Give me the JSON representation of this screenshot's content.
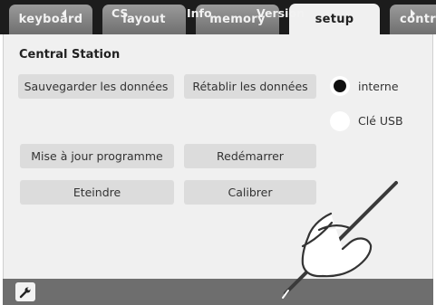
{
  "tabs": [
    {
      "label": "keyboard",
      "active": false
    },
    {
      "label": "layout",
      "active": false
    },
    {
      "label": "memory",
      "active": false
    },
    {
      "label": "setup",
      "active": true
    },
    {
      "label": "control",
      "active": false
    }
  ],
  "section": {
    "title": "Central Station"
  },
  "buttons": {
    "save": "Sauvegarder les données",
    "restore": "Rétablir les données",
    "update": "Mise à jour programme",
    "restart": "Redémarrer",
    "shutdown": "Eteindre",
    "calibrate": "Calibrer"
  },
  "storage": {
    "options": [
      {
        "label": "interne",
        "selected": true
      },
      {
        "label": "Clé USB",
        "selected": false
      }
    ]
  },
  "bottom_bar": {
    "icons": [
      "wrench-icon",
      "arrow-left-icon",
      "arrow-right-icon"
    ],
    "items": [
      "CS",
      "Info",
      "Version"
    ]
  },
  "overlay_icon": "hand-with-stylus-icon",
  "colors": {
    "tabbar": "#1c1c1c",
    "tab": "#808080",
    "panel": "#f0f0f0",
    "button": "#dcdcdc",
    "bottombar": "#6e6e6e"
  }
}
